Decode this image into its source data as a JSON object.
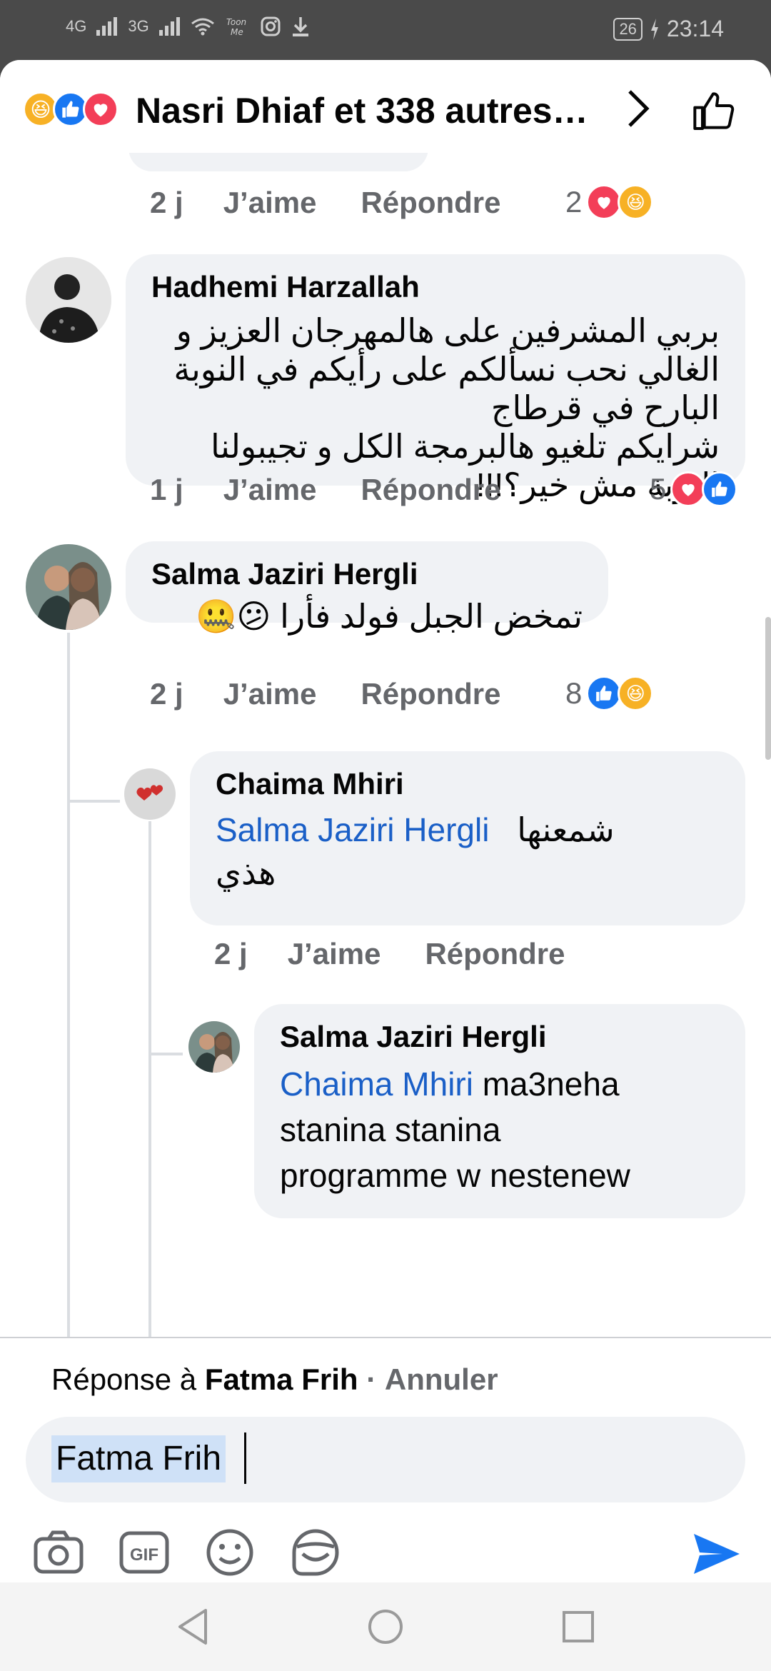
{
  "status_bar": {
    "left_icons": [
      "4G",
      "3G",
      "wifi-icon",
      "toonme-icon",
      "instagram-icon",
      "download-icon"
    ],
    "battery": "26",
    "time": "23:14"
  },
  "header": {
    "reactions": [
      "haha",
      "like",
      "love"
    ],
    "title": "Nasri Dhiaf et 338 autres…"
  },
  "comments": [
    {
      "author": "",
      "time": "2 j",
      "like_label": "J’aime",
      "reply_label": "Répondre",
      "reaction_count": "2",
      "reactions": [
        "love",
        "haha"
      ]
    },
    {
      "author": "Hadhemi Harzallah",
      "text_lines": [
        "بربي المشرفين على هالمهرجان العزيز و",
        "الغالي نحب نسألكم على رأيكم في النوبة",
        "البارح في قرطاج",
        "شرايكم تلغيو هالبرمجة الكل و تجيبولنا",
        "النوبة مش خير؟!!!"
      ],
      "time": "1 j",
      "like_label": "J’aime",
      "reply_label": "Répondre",
      "reaction_count": "5",
      "reactions": [
        "love",
        "like"
      ]
    },
    {
      "author": "Salma Jaziri Hergli",
      "text": "تمخض الجبل فولد فأرا 😕🤐",
      "time": "2 j",
      "like_label": "J’aime",
      "reply_label": "Répondre",
      "reaction_count": "8",
      "reactions": [
        "like",
        "haha"
      ]
    },
    {
      "author": "Chaima Mhiri",
      "mention": "Salma Jaziri Hergli",
      "text_after": "شمعنها",
      "text_line2": "هذي",
      "time": "2 j",
      "like_label": "J’aime",
      "reply_label": "Répondre"
    },
    {
      "author": "Salma Jaziri Hergli",
      "mention": "Chaima Mhiri",
      "text_after": "ma3neha",
      "text_line2": "stanina stanina",
      "text_line3": "programme w nestenew"
    }
  ],
  "reply_bar": {
    "prefix": "Réponse à",
    "target": "Fatma Frih",
    "separator": "·",
    "cancel": "Annuler",
    "input_value": "Fatma Frih",
    "tools": [
      "camera-icon",
      "gif-icon",
      "emoji-icon",
      "sticker-icon"
    ],
    "gif_label": "GIF"
  },
  "colors": {
    "like": "#1877f2",
    "love": "#f33e58",
    "haha": "#f7b125",
    "mention": "#1a5fc7",
    "bubble": "#f0f2f5"
  }
}
